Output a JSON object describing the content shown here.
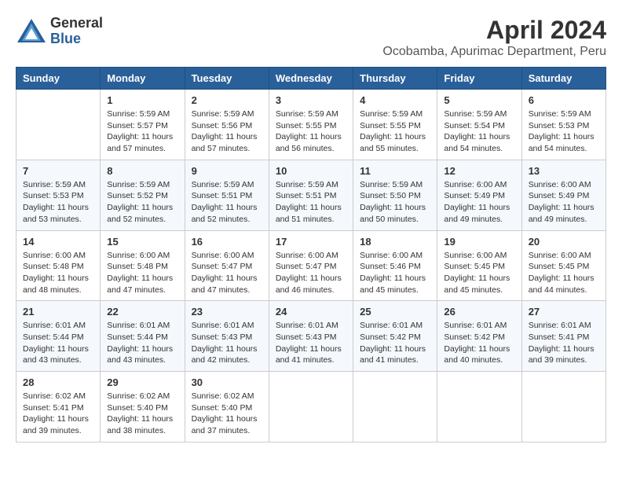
{
  "header": {
    "logo_general": "General",
    "logo_blue": "Blue",
    "month": "April 2024",
    "location": "Ocobamba, Apurimac Department, Peru"
  },
  "calendar": {
    "weekdays": [
      "Sunday",
      "Monday",
      "Tuesday",
      "Wednesday",
      "Thursday",
      "Friday",
      "Saturday"
    ],
    "weeks": [
      [
        {
          "day": "",
          "info": ""
        },
        {
          "day": "1",
          "info": "Sunrise: 5:59 AM\nSunset: 5:57 PM\nDaylight: 11 hours\nand 57 minutes."
        },
        {
          "day": "2",
          "info": "Sunrise: 5:59 AM\nSunset: 5:56 PM\nDaylight: 11 hours\nand 57 minutes."
        },
        {
          "day": "3",
          "info": "Sunrise: 5:59 AM\nSunset: 5:55 PM\nDaylight: 11 hours\nand 56 minutes."
        },
        {
          "day": "4",
          "info": "Sunrise: 5:59 AM\nSunset: 5:55 PM\nDaylight: 11 hours\nand 55 minutes."
        },
        {
          "day": "5",
          "info": "Sunrise: 5:59 AM\nSunset: 5:54 PM\nDaylight: 11 hours\nand 54 minutes."
        },
        {
          "day": "6",
          "info": "Sunrise: 5:59 AM\nSunset: 5:53 PM\nDaylight: 11 hours\nand 54 minutes."
        }
      ],
      [
        {
          "day": "7",
          "info": "Sunrise: 5:59 AM\nSunset: 5:53 PM\nDaylight: 11 hours\nand 53 minutes."
        },
        {
          "day": "8",
          "info": "Sunrise: 5:59 AM\nSunset: 5:52 PM\nDaylight: 11 hours\nand 52 minutes."
        },
        {
          "day": "9",
          "info": "Sunrise: 5:59 AM\nSunset: 5:51 PM\nDaylight: 11 hours\nand 52 minutes."
        },
        {
          "day": "10",
          "info": "Sunrise: 5:59 AM\nSunset: 5:51 PM\nDaylight: 11 hours\nand 51 minutes."
        },
        {
          "day": "11",
          "info": "Sunrise: 5:59 AM\nSunset: 5:50 PM\nDaylight: 11 hours\nand 50 minutes."
        },
        {
          "day": "12",
          "info": "Sunrise: 6:00 AM\nSunset: 5:49 PM\nDaylight: 11 hours\nand 49 minutes."
        },
        {
          "day": "13",
          "info": "Sunrise: 6:00 AM\nSunset: 5:49 PM\nDaylight: 11 hours\nand 49 minutes."
        }
      ],
      [
        {
          "day": "14",
          "info": "Sunrise: 6:00 AM\nSunset: 5:48 PM\nDaylight: 11 hours\nand 48 minutes."
        },
        {
          "day": "15",
          "info": "Sunrise: 6:00 AM\nSunset: 5:48 PM\nDaylight: 11 hours\nand 47 minutes."
        },
        {
          "day": "16",
          "info": "Sunrise: 6:00 AM\nSunset: 5:47 PM\nDaylight: 11 hours\nand 47 minutes."
        },
        {
          "day": "17",
          "info": "Sunrise: 6:00 AM\nSunset: 5:47 PM\nDaylight: 11 hours\nand 46 minutes."
        },
        {
          "day": "18",
          "info": "Sunrise: 6:00 AM\nSunset: 5:46 PM\nDaylight: 11 hours\nand 45 minutes."
        },
        {
          "day": "19",
          "info": "Sunrise: 6:00 AM\nSunset: 5:45 PM\nDaylight: 11 hours\nand 45 minutes."
        },
        {
          "day": "20",
          "info": "Sunrise: 6:00 AM\nSunset: 5:45 PM\nDaylight: 11 hours\nand 44 minutes."
        }
      ],
      [
        {
          "day": "21",
          "info": "Sunrise: 6:01 AM\nSunset: 5:44 PM\nDaylight: 11 hours\nand 43 minutes."
        },
        {
          "day": "22",
          "info": "Sunrise: 6:01 AM\nSunset: 5:44 PM\nDaylight: 11 hours\nand 43 minutes."
        },
        {
          "day": "23",
          "info": "Sunrise: 6:01 AM\nSunset: 5:43 PM\nDaylight: 11 hours\nand 42 minutes."
        },
        {
          "day": "24",
          "info": "Sunrise: 6:01 AM\nSunset: 5:43 PM\nDaylight: 11 hours\nand 41 minutes."
        },
        {
          "day": "25",
          "info": "Sunrise: 6:01 AM\nSunset: 5:42 PM\nDaylight: 11 hours\nand 41 minutes."
        },
        {
          "day": "26",
          "info": "Sunrise: 6:01 AM\nSunset: 5:42 PM\nDaylight: 11 hours\nand 40 minutes."
        },
        {
          "day": "27",
          "info": "Sunrise: 6:01 AM\nSunset: 5:41 PM\nDaylight: 11 hours\nand 39 minutes."
        }
      ],
      [
        {
          "day": "28",
          "info": "Sunrise: 6:02 AM\nSunset: 5:41 PM\nDaylight: 11 hours\nand 39 minutes."
        },
        {
          "day": "29",
          "info": "Sunrise: 6:02 AM\nSunset: 5:40 PM\nDaylight: 11 hours\nand 38 minutes."
        },
        {
          "day": "30",
          "info": "Sunrise: 6:02 AM\nSunset: 5:40 PM\nDaylight: 11 hours\nand 37 minutes."
        },
        {
          "day": "",
          "info": ""
        },
        {
          "day": "",
          "info": ""
        },
        {
          "day": "",
          "info": ""
        },
        {
          "day": "",
          "info": ""
        }
      ]
    ]
  }
}
